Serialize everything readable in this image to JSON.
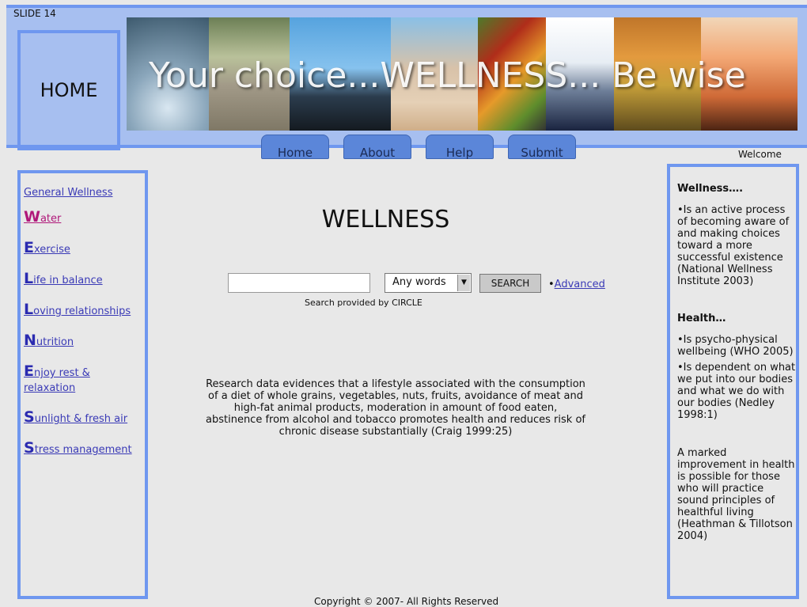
{
  "slide_label": "SLIDE 14",
  "home_box": "HOME",
  "banner": {
    "text": "Your choice...WELLNESS... Be wise"
  },
  "nav": {
    "tabs": [
      "Home",
      "About",
      "Help",
      "Submit"
    ]
  },
  "welcome": "Welcome",
  "sidebar": {
    "items": [
      {
        "initial": "",
        "rest": "General Wellness"
      },
      {
        "initial": "W",
        "rest": "ater"
      },
      {
        "initial": "E",
        "rest": "xercise"
      },
      {
        "initial": "L",
        "rest": "ife in balance"
      },
      {
        "initial": "L",
        "rest": "oving relationships"
      },
      {
        "initial": "N",
        "rest": "utrition"
      },
      {
        "initial": "E",
        "rest": "njoy rest & relaxation"
      },
      {
        "initial": "S",
        "rest": "unlight & fresh air"
      },
      {
        "initial": "S",
        "rest": "tress management"
      }
    ]
  },
  "main": {
    "title": "WELLNESS",
    "search": {
      "input_value": "",
      "select_value": "Any words",
      "button_label": "SEARCH",
      "advanced_bullet": "•",
      "advanced_label": "Advanced",
      "credit": "Search provided by CIRCLE"
    },
    "research_text": "Research data evidences that a lifestyle associated with the consumption of a diet of whole grains, vegetables, nuts, fruits, avoidance of meat and high-fat animal products, moderation in amount of food eaten, abstinence from alcohol and tobacco promotes health and reduces risk of chronic disease substantially (Craig 1999:25)"
  },
  "right_panel": {
    "heading1": "Wellness….",
    "item1": "•Is an active process of becoming aware of and making choices toward a more successful existence (National Wellness Institute 2003)",
    "heading2": "Health…",
    "item2": "•Is psycho-physical wellbeing (WHO 2005)",
    "item3": "•Is dependent on what we put into our bodies and what we do with our bodies (Nedley 1998:1)",
    "item4": "A marked improvement in health is possible for those who will practice sound principles of healthful living (Heathman & Tillotson 2004)"
  },
  "footer": {
    "copyright": "Copyright  © 2007- All Rights Reserved"
  },
  "colors": {
    "band": "#a7bff0",
    "border_accent": "#6f97ef",
    "tab": "#5b86d9",
    "link": "#3a3ab6",
    "link_active": "#b0187a",
    "background": "#e8e8e8"
  },
  "icons": {
    "select_arrow": "chevron-down-icon"
  }
}
